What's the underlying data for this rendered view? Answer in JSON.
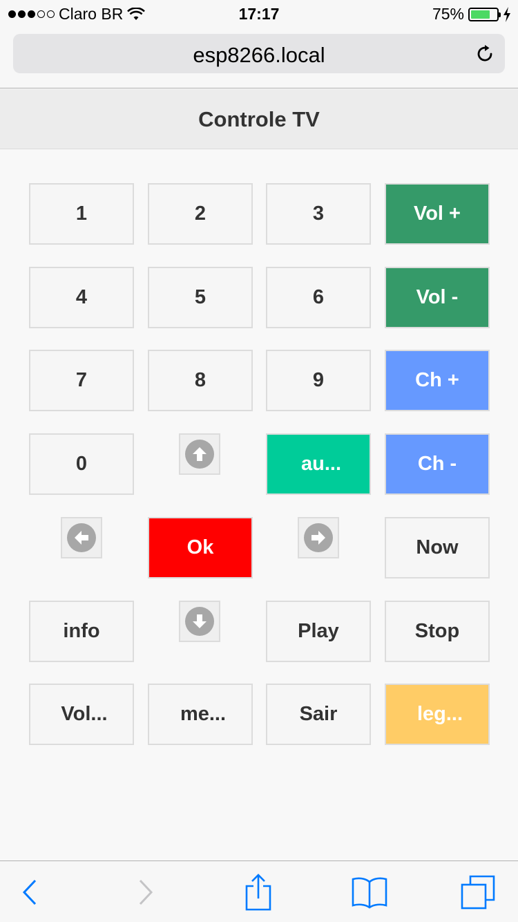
{
  "status_bar": {
    "carrier": "Claro BR",
    "time": "17:17",
    "battery": "75%",
    "battery_level": 0.75,
    "signal_bars": 3
  },
  "browser": {
    "url": "esp8266.local"
  },
  "page": {
    "title": "Controle TV"
  },
  "buttons": {
    "b1": "1",
    "b2": "2",
    "b3": "3",
    "vol_up": "Vol +",
    "b4": "4",
    "b5": "5",
    "b6": "6",
    "vol_down": "Vol -",
    "b7": "7",
    "b8": "8",
    "b9": "9",
    "ch_up": "Ch +",
    "b0": "0",
    "au": "au...",
    "ch_down": "Ch -",
    "ok": "Ok",
    "now": "Now",
    "info": "info",
    "play": "Play",
    "stop": "Stop",
    "vol_more": "Vol...",
    "menu": "me...",
    "sair": "Sair",
    "legenda": "leg..."
  },
  "colors": {
    "green": "#359a69",
    "blue": "#6699ff",
    "teal": "#00cc99",
    "red": "#ff0000",
    "yellow": "#ffcc66",
    "ios_blue": "#007aff"
  },
  "icons": {
    "wifi": "wifi-icon",
    "reload": "reload-icon",
    "up": "arrow-up-icon",
    "down": "arrow-down-icon",
    "left": "arrow-left-icon",
    "right": "arrow-right-icon",
    "back": "back-chevron-icon",
    "forward": "forward-chevron-icon",
    "share": "share-icon",
    "bookmarks": "bookmarks-icon",
    "tabs": "tabs-icon"
  }
}
